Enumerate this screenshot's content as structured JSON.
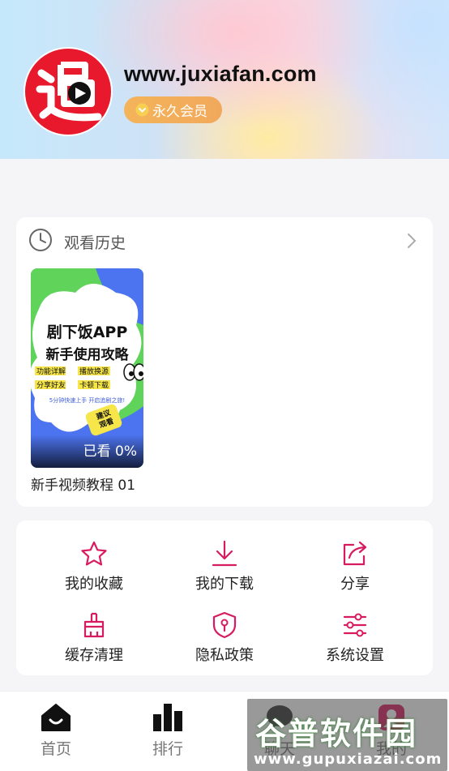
{
  "profile": {
    "site_name": "www.juxiafan.com",
    "vip_label": "永久会员",
    "logo_text": "追"
  },
  "history": {
    "title": "观看历史",
    "items": [
      {
        "title": "新手视频教程 01",
        "progress": "已看 0%",
        "poster": {
          "line1": "剧下饭APP",
          "line2": "新手使用攻略",
          "tags": [
            "功能详解",
            "播放换源",
            "分享好友",
            "卡顿下载"
          ],
          "tagline": "5分钟快速上手 开启追剧之旅!",
          "sticker": "建议\n观看"
        }
      }
    ]
  },
  "menu": {
    "items": [
      {
        "label": "我的收藏",
        "icon": "star-icon"
      },
      {
        "label": "我的下载",
        "icon": "download-icon"
      },
      {
        "label": "分享",
        "icon": "share-icon"
      },
      {
        "label": "缓存清理",
        "icon": "broom-icon"
      },
      {
        "label": "隐私政策",
        "icon": "shield-icon"
      },
      {
        "label": "系统设置",
        "icon": "sliders-icon"
      }
    ]
  },
  "tabbar": {
    "tabs": [
      {
        "label": "首页",
        "icon": "home-icon"
      },
      {
        "label": "排行",
        "icon": "chart-icon"
      },
      {
        "label": "聊天",
        "icon": "chat-icon"
      },
      {
        "label": "我的",
        "icon": "profile-icon"
      }
    ]
  },
  "watermark": {
    "main": "谷普软件园",
    "url": "www.gupuxiazai.com"
  },
  "colors": {
    "accent": "#d81b60",
    "vip": "#f3b05a",
    "logo_red": "#e8192c"
  }
}
